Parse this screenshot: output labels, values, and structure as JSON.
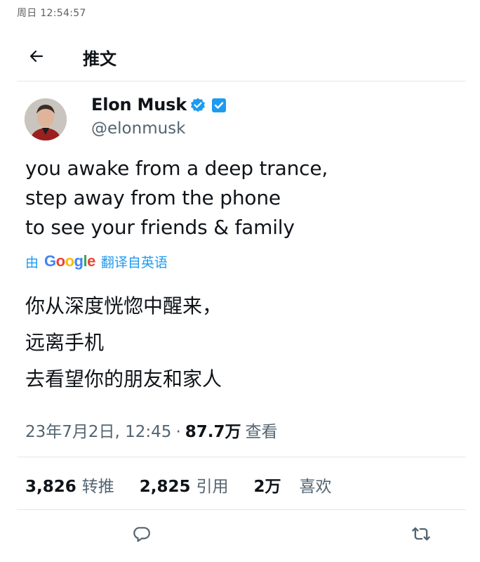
{
  "status_bar": {
    "time": "周日 12:54:57"
  },
  "nav": {
    "title": "推文"
  },
  "author": {
    "name": "Elon Musk",
    "handle": "@elonmusk"
  },
  "tweet": {
    "lines": [
      "you awake from a deep trance,",
      "step away from the phone",
      "to see your friends & family"
    ]
  },
  "translation": {
    "prefix": "由",
    "google_letters": [
      "G",
      "o",
      "o",
      "g",
      "l",
      "e"
    ],
    "google_colors": [
      "#4285F4",
      "#EA4335",
      "#FBBC05",
      "#4285F4",
      "#34A853",
      "#EA4335"
    ],
    "suffix": "翻译自英语",
    "lines": [
      "你从深度恍惚中醒来，",
      "远离手机",
      "去看望你的朋友和家人"
    ]
  },
  "meta": {
    "datetime": "23年7月2日, 12:45",
    "separator": "·",
    "views_count": "87.7万",
    "views_label": "查看"
  },
  "stats": {
    "retweets_count": "3,826",
    "retweets_label": "转推",
    "quotes_count": "2,825",
    "quotes_label": "引用",
    "likes_count": "2万",
    "likes_label": "喜欢"
  },
  "icons": {
    "back": "arrow-left-icon",
    "verified": "verified-badge-icon",
    "affiliate": "affiliate-badge-icon",
    "reply": "reply-icon",
    "retweet": "retweet-icon"
  },
  "colors": {
    "accent": "#1d9bf0",
    "text": "#0f1419",
    "secondary": "#536471"
  }
}
